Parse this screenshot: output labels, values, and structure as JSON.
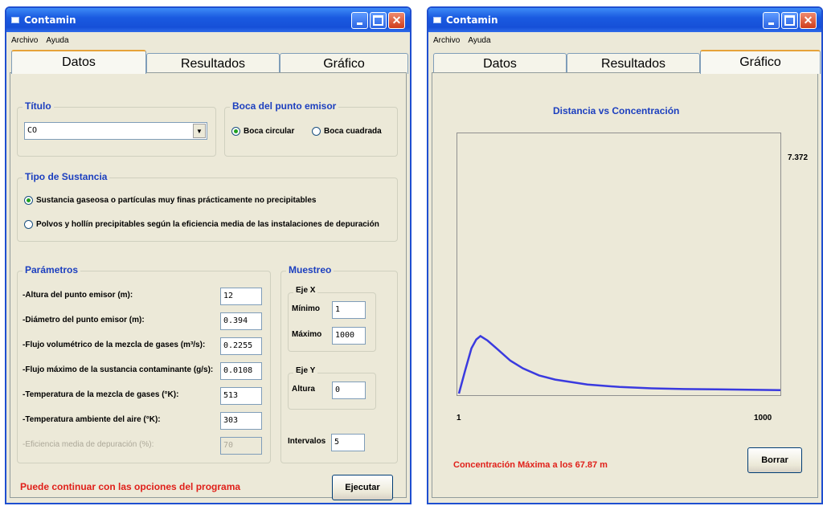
{
  "window_left": {
    "title": "Contamin",
    "menu": [
      "Archivo",
      "Ayuda"
    ],
    "tabs": [
      "Datos",
      "Resultados",
      "Gráfico"
    ],
    "active_tab": "Datos",
    "titulo": {
      "label": "Título",
      "value": "CO"
    },
    "boca": {
      "label": "Boca del punto emisor",
      "options": [
        "Boca circular",
        "Boca cuadrada"
      ],
      "selected": "Boca circular"
    },
    "sustancia": {
      "label": "Tipo de Sustancia",
      "options": [
        "Sustancia gaseosa o partículas muy finas prácticamente no precipitables",
        "Polvos y hollín precipitables según la eficiencia media de las instalaciones de depuración"
      ],
      "selected": 0
    },
    "parametros": {
      "label": "Parámetros",
      "rows": [
        {
          "label": "-Altura del punto emisor (m):",
          "value": "12"
        },
        {
          "label": "-Diámetro del punto emisor (m):",
          "value": "0.394"
        },
        {
          "label": "-Flujo volumétrico de la mezcla de gases (m³/s):",
          "value": "0.2255"
        },
        {
          "label": "-Flujo máximo de la sustancia contaminante (g/s):",
          "value": "0.0108"
        },
        {
          "label": "-Temperatura de la mezcla de gases (°K):",
          "value": "513"
        },
        {
          "label": "-Temperatura ambiente del aire (°K):",
          "value": "303"
        },
        {
          "label": "-Eficiencia media de depuración (%):",
          "value": "70"
        }
      ]
    },
    "muestreo": {
      "label": "Muestreo",
      "eje_x": {
        "label": "Eje X",
        "min_label": "Mínimo",
        "min_value": "1",
        "max_label": "Máximo",
        "max_value": "1000"
      },
      "eje_y": {
        "label": "Eje Y",
        "altura_label": "Altura",
        "altura_value": "0"
      },
      "intervalos_label": "Intervalos",
      "intervalos_value": "5"
    },
    "status": "Puede continuar con las opciones del programa",
    "ejecutar_label": "Ejecutar"
  },
  "window_right": {
    "title": "Contamin",
    "menu": [
      "Archivo",
      "Ayuda"
    ],
    "tabs": [
      "Datos",
      "Resultados",
      "Gráfico"
    ],
    "active_tab": "Gráfico",
    "status": "Concentración Máxima a los  67.87 m",
    "borrar_label": "Borrar"
  },
  "chart_data": {
    "type": "line",
    "title": "Distancia vs Concentración",
    "xlabel": "",
    "ylabel": "",
    "xlim": [
      1,
      1000
    ],
    "ylim": [
      0,
      7.372
    ],
    "x_tick_labels": [
      "1",
      "1000"
    ],
    "y_tick_labels": [
      "7.372"
    ],
    "grid": false,
    "series": [
      {
        "color": "#3a3adf",
        "x": [
          1,
          20,
          40,
          55,
          67.87,
          90,
          120,
          160,
          200,
          250,
          300,
          400,
          500,
          600,
          700,
          800,
          900,
          1000
        ],
        "y": [
          0.0,
          0.65,
          1.3,
          1.55,
          1.65,
          1.52,
          1.28,
          0.95,
          0.72,
          0.52,
          0.4,
          0.26,
          0.19,
          0.15,
          0.13,
          0.12,
          0.11,
          0.1
        ]
      }
    ]
  },
  "colors": {
    "titlebar": "#1650d8",
    "group_title": "#1c3fbf",
    "status_red": "#e0201a",
    "plot_line": "#3a3adf"
  },
  "icons": [
    "app-icon",
    "minimize-icon",
    "maximize-icon",
    "close-icon",
    "combo-arrow-icon"
  ]
}
